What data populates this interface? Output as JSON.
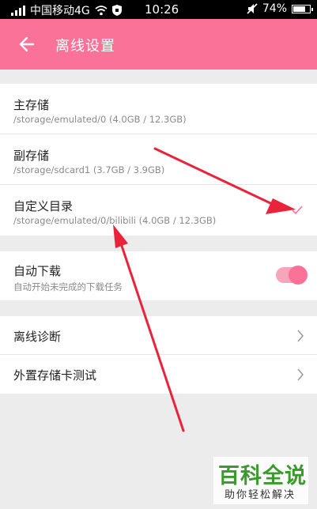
{
  "status_bar": {
    "carrier": "中国移动4G",
    "time": "10:26",
    "battery": "74%"
  },
  "app_bar": {
    "title": "离线设置"
  },
  "storage": [
    {
      "label": "主存储",
      "path": "/storage/emulated/0 (4.0GB / 12.3GB)"
    },
    {
      "label": "副存储",
      "path": "/storage/sdcard1 (3.7GB / 3.9GB)"
    },
    {
      "label": "自定义目录",
      "path": "/storage/emulated/0/bilibili (4.0GB / 12.3GB)",
      "selected": true
    }
  ],
  "auto_download": {
    "label": "自动下载",
    "description": "自动开始未完成的下载任务",
    "enabled": true
  },
  "menu": [
    {
      "label": "离线诊断"
    },
    {
      "label": "外置存储卡测试"
    }
  ],
  "watermark": {
    "main": "百科全说",
    "sub": "助你轻松解决"
  },
  "colors": {
    "accent": "#fb7299",
    "annotation_arrow": "#e8233a",
    "watermark_green": "#3a9a2c"
  }
}
